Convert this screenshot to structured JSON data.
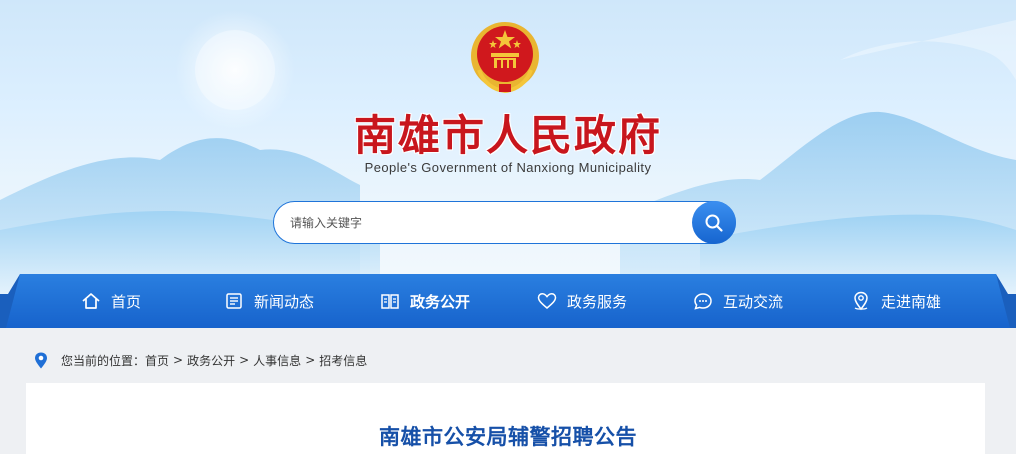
{
  "header": {
    "title": "南雄市人民政府",
    "subtitle": "People's Government of Nanxiong Municipality",
    "emblem_icon": "national-emblem-icon"
  },
  "search": {
    "placeholder": "请输入关键字",
    "button_icon": "search-icon"
  },
  "nav": {
    "items": [
      {
        "label": "首页",
        "icon": "home-icon",
        "active": false
      },
      {
        "label": "新闻动态",
        "icon": "news-icon",
        "active": false
      },
      {
        "label": "政务公开",
        "icon": "book-icon",
        "active": true
      },
      {
        "label": "政务服务",
        "icon": "heart-icon",
        "active": false
      },
      {
        "label": "互动交流",
        "icon": "chat-icon",
        "active": false
      },
      {
        "label": "走进南雄",
        "icon": "location-icon",
        "active": false
      }
    ]
  },
  "breadcrumb": {
    "prefix": "您当前的位置：",
    "items": [
      "首页",
      "政务公开",
      "人事信息",
      "招考信息"
    ],
    "separator": ">"
  },
  "article": {
    "title": "南雄市公安局辅警招聘公告"
  },
  "colors": {
    "nav_blue": "#1f6fd6",
    "title_red": "#c8161d",
    "article_title_blue": "#1650a8"
  }
}
